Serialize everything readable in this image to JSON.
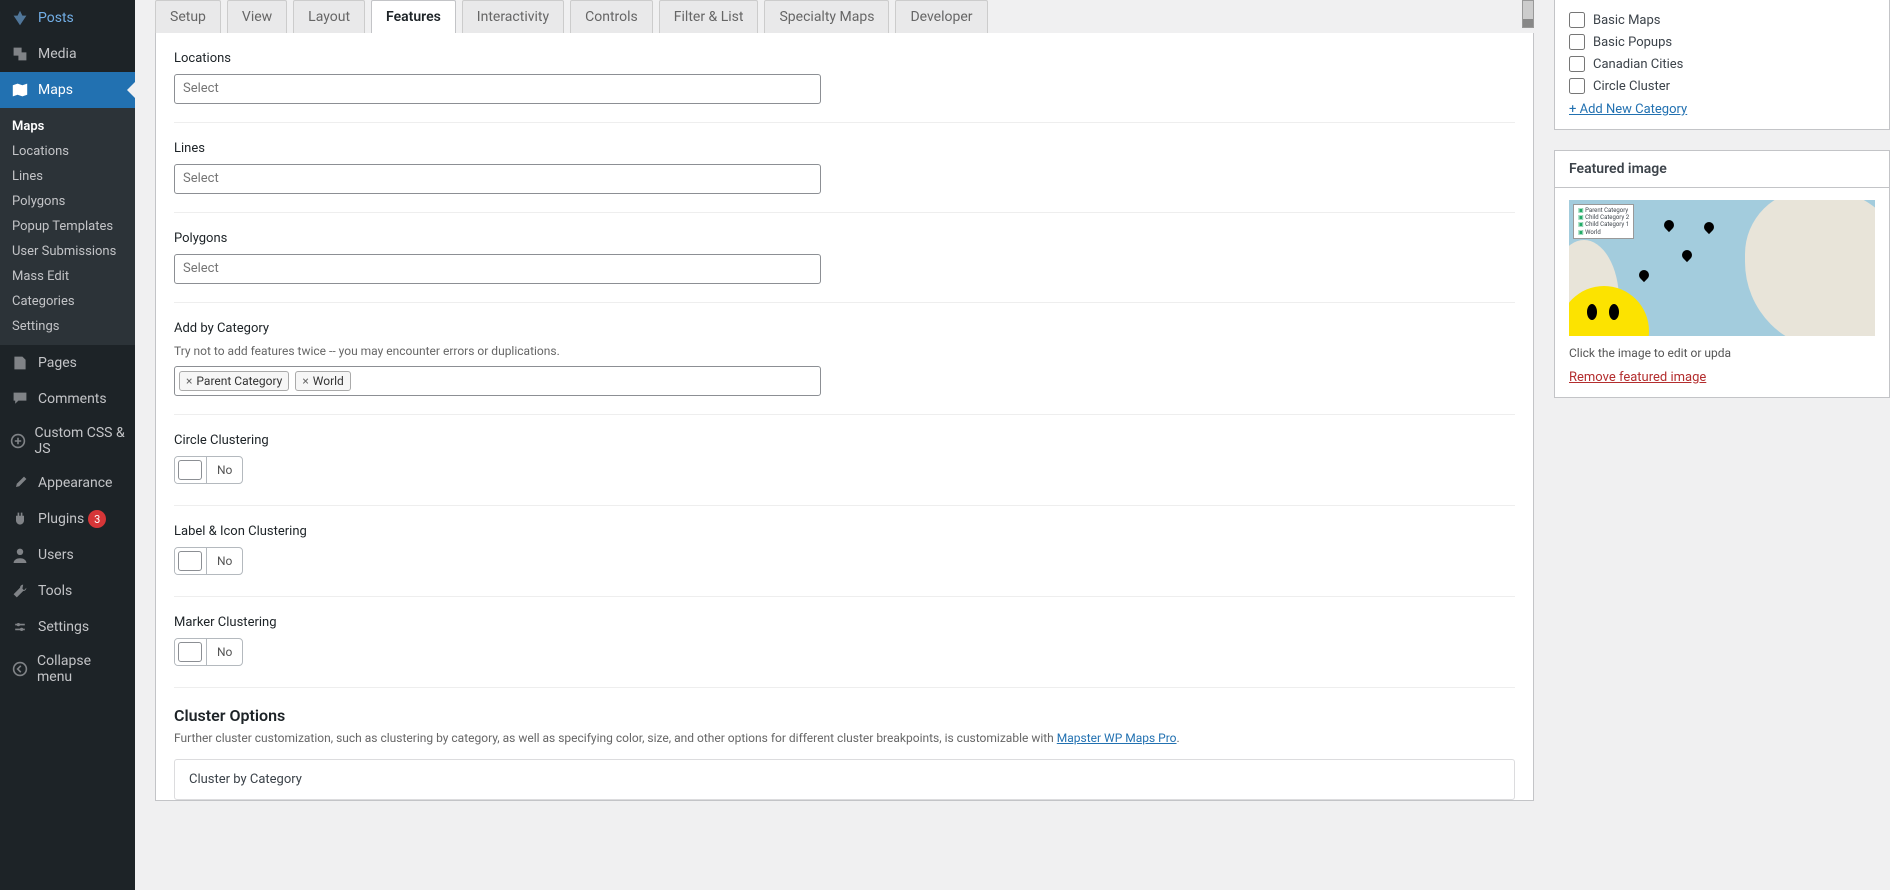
{
  "sidebar": {
    "items": [
      {
        "label": "Posts",
        "icon": "pin"
      },
      {
        "label": "Media",
        "icon": "media"
      },
      {
        "label": "Maps",
        "icon": "map",
        "active": true
      },
      {
        "label": "Pages",
        "icon": "pages"
      },
      {
        "label": "Comments",
        "icon": "comment"
      },
      {
        "label": "Custom CSS & JS",
        "icon": "plus"
      },
      {
        "label": "Appearance",
        "icon": "brush"
      },
      {
        "label": "Plugins",
        "icon": "plug",
        "badge": "3"
      },
      {
        "label": "Users",
        "icon": "user"
      },
      {
        "label": "Tools",
        "icon": "wrench"
      },
      {
        "label": "Settings",
        "icon": "settings"
      },
      {
        "label": "Collapse menu",
        "icon": "collapse"
      }
    ],
    "submenu": [
      {
        "label": "Maps",
        "current": true
      },
      {
        "label": "Locations"
      },
      {
        "label": "Lines"
      },
      {
        "label": "Polygons"
      },
      {
        "label": "Popup Templates"
      },
      {
        "label": "User Submissions"
      },
      {
        "label": "Mass Edit"
      },
      {
        "label": "Categories"
      },
      {
        "label": "Settings"
      }
    ]
  },
  "tabs": [
    {
      "label": "Setup"
    },
    {
      "label": "View"
    },
    {
      "label": "Layout"
    },
    {
      "label": "Features",
      "active": true
    },
    {
      "label": "Interactivity"
    },
    {
      "label": "Controls"
    },
    {
      "label": "Filter & List"
    },
    {
      "label": "Specialty Maps"
    },
    {
      "label": "Developer"
    }
  ],
  "fields": {
    "locations": {
      "label": "Locations",
      "placeholder": "Select"
    },
    "lines": {
      "label": "Lines",
      "placeholder": "Select"
    },
    "polygons": {
      "label": "Polygons",
      "placeholder": "Select"
    },
    "addByCategory": {
      "label": "Add by Category",
      "help": "Try not to add features twice -- you may encounter errors or duplications.",
      "tags": [
        "Parent Category",
        "World"
      ]
    },
    "circleClustering": {
      "label": "Circle Clustering",
      "value": "No"
    },
    "labelIconClustering": {
      "label": "Label & Icon Clustering",
      "value": "No"
    },
    "markerClustering": {
      "label": "Marker Clustering",
      "value": "No"
    }
  },
  "clusterOptions": {
    "heading": "Cluster Options",
    "help_pre": "Further cluster customization, such as clustering by category, as well as specifying color, size, and other options for different cluster breakpoints, is customizable with ",
    "help_link": "Mapster WP Maps Pro",
    "help_post": ".",
    "inner": "Cluster by Category"
  },
  "categories": {
    "items": [
      "Basic Maps",
      "Basic Popups",
      "Canadian Cities",
      "Circle Cluster"
    ],
    "addNew": "+ Add New Category"
  },
  "featuredImage": {
    "heading": "Featured image",
    "legend": [
      "Parent Category",
      "Child Category 2",
      "Child Category 1",
      "World"
    ],
    "hint": "Click the image to edit or upda",
    "remove": "Remove featured image"
  }
}
